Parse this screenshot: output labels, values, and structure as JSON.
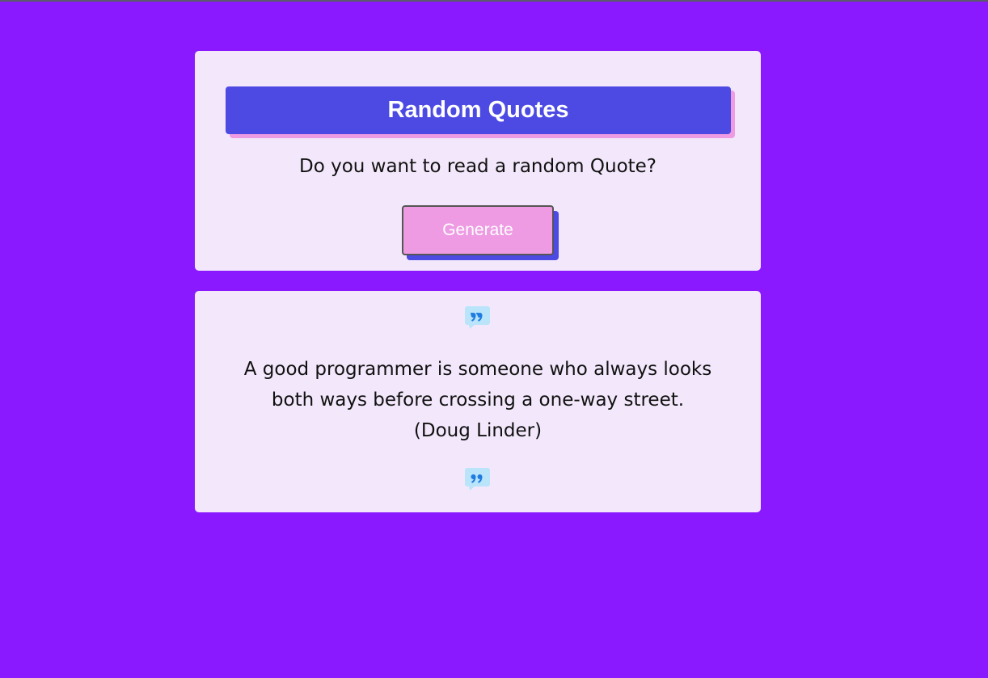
{
  "header": {
    "title": "Random Quotes",
    "prompt": "Do you want to read a random Quote?",
    "generate_label": "Generate"
  },
  "quote": {
    "text": "A good programmer is someone who always looks both ways before crossing a one-way street. (Doug Linder)",
    "open_icon": "quote-speech-bubble-icon",
    "close_icon": "quote-speech-bubble-icon"
  },
  "colors": {
    "background": "#8b19ff",
    "card": "#f3e8fb",
    "title_bar": "#4c4ae3",
    "accent_pink": "#ee9be3"
  }
}
